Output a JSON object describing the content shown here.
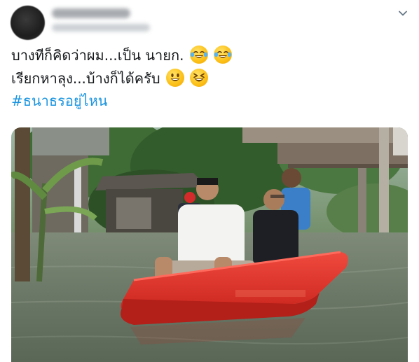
{
  "tweet": {
    "line1": "บางทีก็คิดว่าผม...เป็น นายก.",
    "line2": "เรียกหาลุง...บ้างก็ได้ครับ",
    "hashtag": "#ธนาธรอยู่ไหน"
  },
  "icons": {
    "menu": "chevron-down-icon",
    "line1_emojis": [
      "tears-of-joy-emoji",
      "tears-of-joy-emoji"
    ],
    "line2_emojis": [
      "grinning-face-emoji",
      "squinting-laughing-face-emoji"
    ]
  },
  "colors": {
    "text": "#14171a",
    "hashtag": "#1b95e0",
    "chevron": "#657786",
    "boat": "#e8382f",
    "water": "#6e7a6b"
  }
}
